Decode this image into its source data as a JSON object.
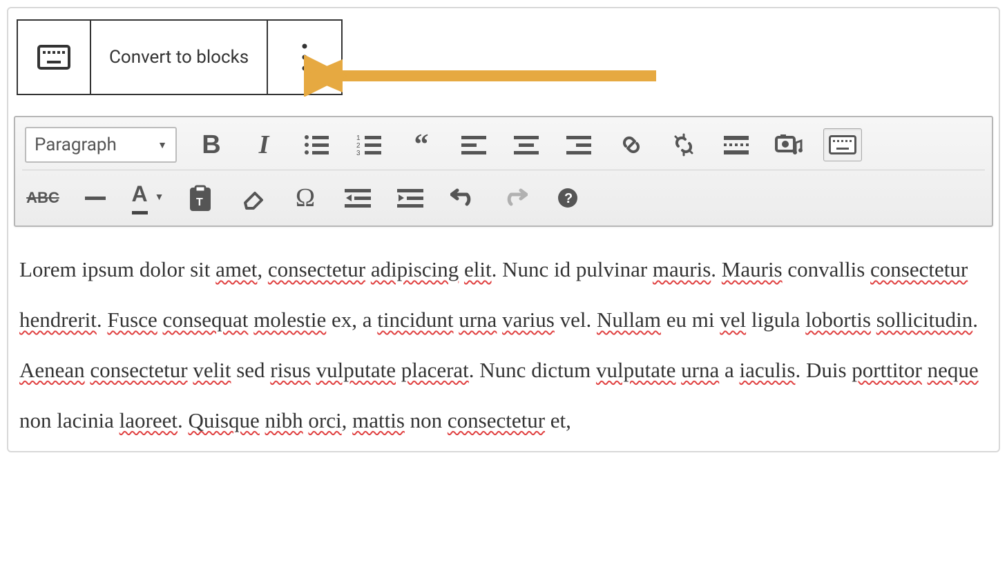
{
  "block_toolbar": {
    "convert_label": "Convert to blocks",
    "more_label": ":"
  },
  "format_dropdown": {
    "selected": "Paragraph"
  },
  "content": {
    "parts": [
      {
        "t": "Lorem ipsum dolor sit ",
        "s": false
      },
      {
        "t": "amet",
        "s": true
      },
      {
        "t": ", ",
        "s": false
      },
      {
        "t": "consectetur",
        "s": true
      },
      {
        "t": " ",
        "s": false
      },
      {
        "t": "adipiscing",
        "s": true
      },
      {
        "t": " ",
        "s": false
      },
      {
        "t": "elit",
        "s": true
      },
      {
        "t": ". Nunc id pulvinar ",
        "s": false
      },
      {
        "t": "mauris",
        "s": true
      },
      {
        "t": ". ",
        "s": false
      },
      {
        "t": "Mauris",
        "s": true
      },
      {
        "t": " convallis ",
        "s": false
      },
      {
        "t": "consectetur",
        "s": true
      },
      {
        "t": " ",
        "s": false
      },
      {
        "t": "hendrerit",
        "s": true
      },
      {
        "t": ". ",
        "s": false
      },
      {
        "t": "Fusce",
        "s": true
      },
      {
        "t": " ",
        "s": false
      },
      {
        "t": "consequat",
        "s": true
      },
      {
        "t": " ",
        "s": false
      },
      {
        "t": "molestie",
        "s": true
      },
      {
        "t": " ex, a ",
        "s": false
      },
      {
        "t": "tincidunt",
        "s": true
      },
      {
        "t": " ",
        "s": false
      },
      {
        "t": "urna",
        "s": true
      },
      {
        "t": " ",
        "s": false
      },
      {
        "t": "varius",
        "s": true
      },
      {
        "t": " vel. ",
        "s": false
      },
      {
        "t": "Nullam",
        "s": true
      },
      {
        "t": " eu mi ",
        "s": false
      },
      {
        "t": "vel",
        "s": true
      },
      {
        "t": " ligula ",
        "s": false
      },
      {
        "t": "lobortis",
        "s": true
      },
      {
        "t": " ",
        "s": false
      },
      {
        "t": "sollicitudin",
        "s": true
      },
      {
        "t": ". ",
        "s": false
      },
      {
        "t": "Aenean",
        "s": true
      },
      {
        "t": " ",
        "s": false
      },
      {
        "t": "consectetur",
        "s": true
      },
      {
        "t": " ",
        "s": false
      },
      {
        "t": "velit",
        "s": true
      },
      {
        "t": " sed ",
        "s": false
      },
      {
        "t": "risus",
        "s": true
      },
      {
        "t": " ",
        "s": false
      },
      {
        "t": "vulputate",
        "s": true
      },
      {
        "t": " ",
        "s": false
      },
      {
        "t": "placerat",
        "s": true
      },
      {
        "t": ". Nunc dictum ",
        "s": false
      },
      {
        "t": "vulputate",
        "s": true
      },
      {
        "t": " ",
        "s": false
      },
      {
        "t": "urna",
        "s": true
      },
      {
        "t": " a ",
        "s": false
      },
      {
        "t": "iaculis",
        "s": true
      },
      {
        "t": ". Duis ",
        "s": false
      },
      {
        "t": "porttitor",
        "s": true
      },
      {
        "t": " ",
        "s": false
      },
      {
        "t": "neque",
        "s": true
      },
      {
        "t": " non lacinia ",
        "s": false
      },
      {
        "t": "laoreet",
        "s": true
      },
      {
        "t": ". ",
        "s": false
      },
      {
        "t": "Quisque",
        "s": true
      },
      {
        "t": " ",
        "s": false
      },
      {
        "t": "nibh",
        "s": true
      },
      {
        "t": " ",
        "s": false
      },
      {
        "t": "orci",
        "s": true
      },
      {
        "t": ", ",
        "s": false
      },
      {
        "t": "mattis",
        "s": true
      },
      {
        "t": " non ",
        "s": false
      },
      {
        "t": "consectetur",
        "s": true
      },
      {
        "t": " et,",
        "s": false
      }
    ]
  },
  "annotation": {
    "arrow_color": "#e6a941"
  }
}
